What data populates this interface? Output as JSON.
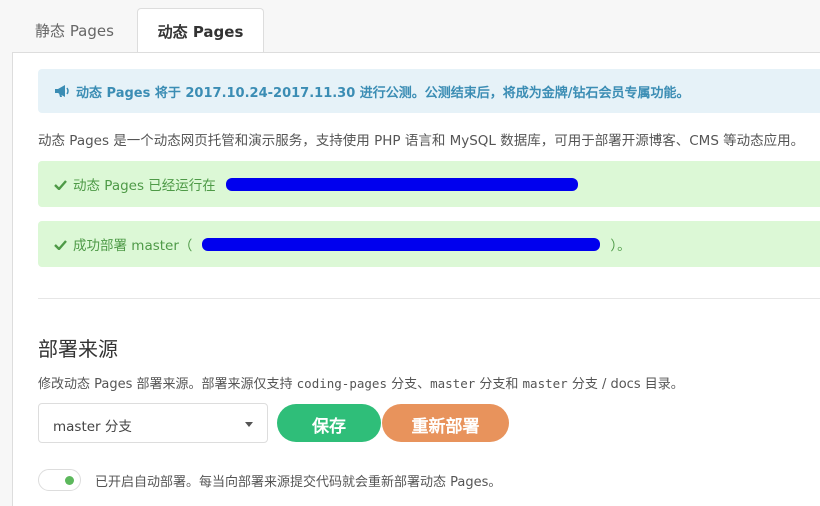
{
  "tabs": {
    "static_label": "静态 Pages",
    "dynamic_label": "动态 Pages"
  },
  "notice": {
    "text": "动态 Pages 将于 2017.10.24-2017.11.30 进行公测。公测结束后，将成为金牌/钻石会员专属功能。",
    "icon": "megaphone-icon"
  },
  "description": "动态 Pages 是一个动态网页托管和演示服务，支持使用 PHP 语言和 MySQL 数据库，可用于部署开源博客、CMS 等动态应用。",
  "status": {
    "running_text": "动态 Pages 已经运行在",
    "deploy_prefix": "成功部署 master（",
    "deploy_suffix": "）。",
    "icon": "check-icon"
  },
  "source": {
    "title": "部署来源",
    "desc_1": "修改动态 Pages 部署来源。部署来源仅支持 ",
    "branch_1": "coding-pages",
    "desc_2": " 分支、",
    "branch_2": "master",
    "desc_3": " 分支和 ",
    "branch_3": "master",
    "desc_4": " 分支 / docs 目录。",
    "selected": "master 分支",
    "save_label": "保存",
    "redeploy_label": "重新部署"
  },
  "auto_deploy": {
    "enabled": true,
    "label": "已开启自动部署。每当向部署来源提交代码就会重新部署动态 Pages。"
  },
  "colors": {
    "save": "#2fbe79",
    "redeploy": "#e8935c",
    "notice_bg": "#e6f2f8",
    "success_bg": "#dcf8d6",
    "redaction": "#0000ee"
  }
}
